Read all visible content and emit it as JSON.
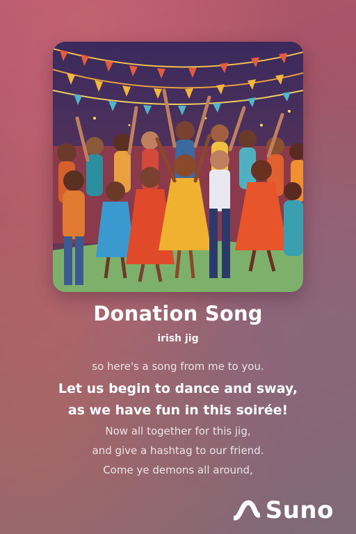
{
  "song": {
    "title": "Donation Song",
    "style": "irish jig"
  },
  "lyrics": {
    "previous": "so here's a song from me to you.",
    "current": [
      "Let us begin to dance and sway,",
      "as we have fun in this soirée!"
    ],
    "upcoming": [
      "Now all together for this jig,",
      "and give a hashtag to our friend.",
      "Come ye demons all around,"
    ]
  },
  "branding": {
    "logo_text": "Suno"
  },
  "cover_art": {
    "icon": "dancing-crowd-illustration"
  },
  "colors": {
    "background_top": "#b4566c",
    "background_bottom": "#7e6a78",
    "text": "#ffffff"
  }
}
